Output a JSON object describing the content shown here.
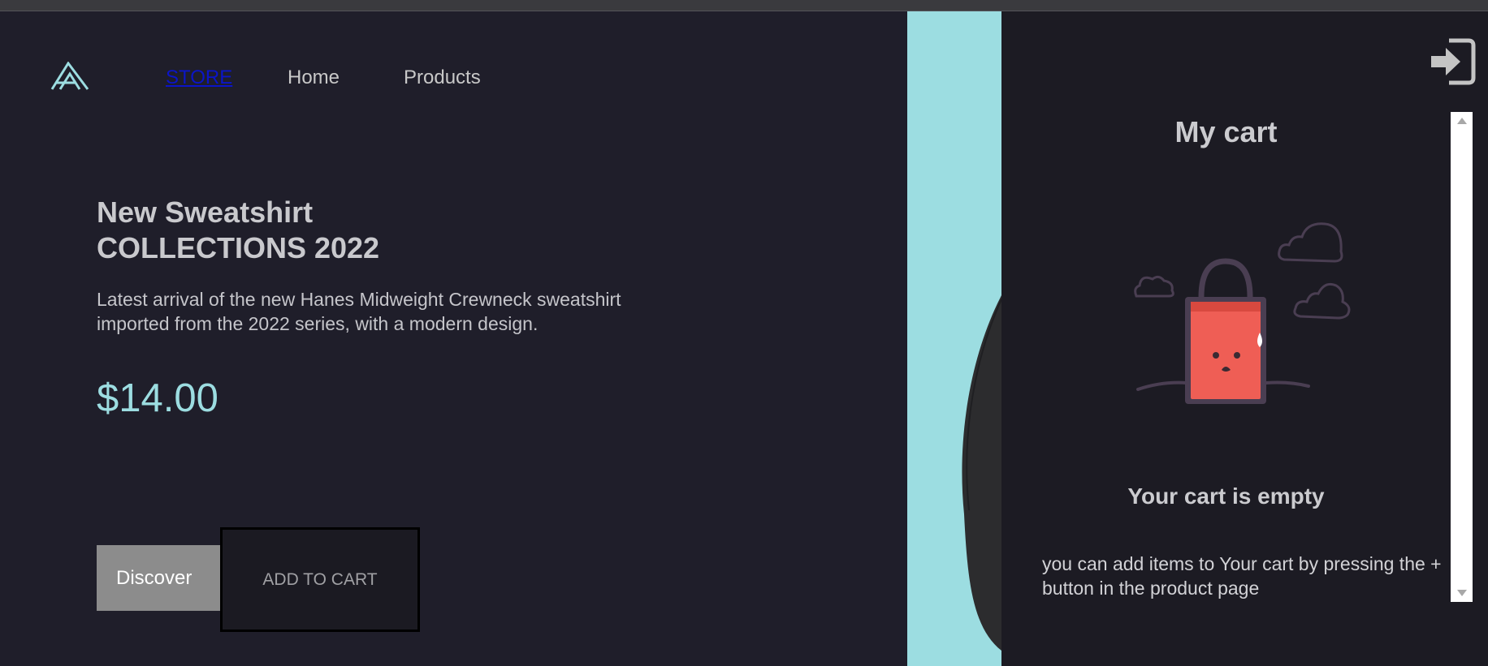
{
  "nav": {
    "brand_icon": "brand-a-logo-icon",
    "links": [
      {
        "label": "STORE"
      },
      {
        "label": "Home"
      },
      {
        "label": "Products"
      }
    ]
  },
  "hero": {
    "title_line1": "New Sweatshirt",
    "title_line2": "COLLECTIONS 2022",
    "description": "Latest arrival of the new Hanes Midweight Crewneck sweatshirt imported from the 2022 series, with a modern design.",
    "price": "$14.00",
    "discover_label": "Discover",
    "add_to_cart_label": "ADD TO CART"
  },
  "cart": {
    "title": "My cart",
    "empty_title": "Your cart is empty",
    "empty_text": "you can add items to Your cart by pressing the + button in the product page",
    "exit_icon": "sign-out-icon",
    "illustration_icon": "sad-shopping-bag-icon"
  },
  "colors": {
    "background": "#1f1e2a",
    "accent": "#9cdde1",
    "cart_panel": "#1c1b23",
    "bag": "#ef5e55"
  }
}
